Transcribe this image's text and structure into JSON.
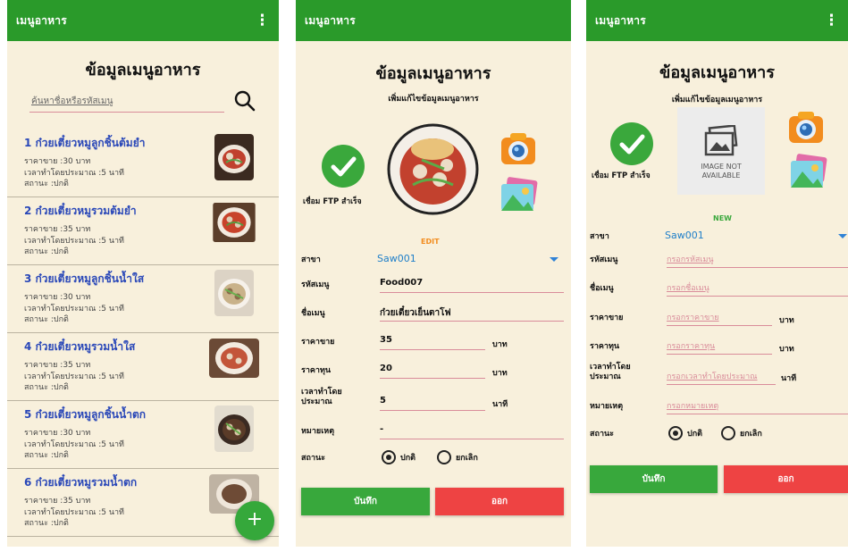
{
  "app_title": "เมนูอาหาร",
  "list_screen": {
    "page_title": "ข้อมูลเมนูอาหาร",
    "search_placeholder": "ค้นหาชื่อหรือรหัสเมนู",
    "items": [
      {
        "name": "1 ก๋วยเตี๋ยวหมูลูกชิ้นต้มยำ",
        "price": "ราคาขาย :30 บาท",
        "time": "เวลาทำโดยประมาณ :5 นาที",
        "status": "สถานะ :ปกติ"
      },
      {
        "name": "2 ก๋วยเตี๋ยวหมูรวมต้มยำ",
        "price": "ราคาขาย :35 บาท",
        "time": "เวลาทำโดยประมาณ :5 นาที",
        "status": "สถานะ :ปกติ"
      },
      {
        "name": "3 ก๋วยเตี๋ยวหมูลูกชิ้นน้ำใส",
        "price": "ราคาขาย :30 บาท",
        "time": "เวลาทำโดยประมาณ :5 นาที",
        "status": "สถานะ :ปกติ"
      },
      {
        "name": "4 ก๋วยเตี๋ยวหมูรวมน้ำใส",
        "price": "ราคาขาย :35 บาท",
        "time": "เวลาทำโดยประมาณ :5 นาที",
        "status": "สถานะ :ปกติ"
      },
      {
        "name": "5 ก๋วยเตี๋ยวหมูลูกชิ้นน้ำตก",
        "price": "ราคาขาย :30 บาท",
        "time": "เวลาทำโดยประมาณ :5 นาที",
        "status": "สถานะ :ปกติ"
      },
      {
        "name": "6 ก๋วยเตี๋ยวหมูรวมน้ำตก",
        "price": "ราคาขาย :35 บาท",
        "time": "เวลาทำโดยประมาณ :5 นาที",
        "status": "สถานะ :ปกติ"
      }
    ],
    "fab_label": "+"
  },
  "edit_screen": {
    "page_title": "ข้อมูลเมนูอาหาร",
    "subtitle": "เพิ่มแก้ไขข้อมูลเมนูอาหาร",
    "ftp_status": "เชื่อม FTP สำเร็จ",
    "mode": "EDIT",
    "labels": {
      "branch": "สาขา",
      "code": "รหัสเมนู",
      "name": "ชื่อเมนู",
      "sell_price": "ราคาขาย",
      "cost_price": "ราคาทุน",
      "time": "เวลาทำโดย ประมาณ",
      "note": "หมายเหตุ",
      "status": "สถานะ"
    },
    "values": {
      "branch": "Saw001",
      "code": "Food007",
      "name": "ก๋วยเตี๋ยวเย็นตาโฟ",
      "sell_price": "35",
      "cost_price": "20",
      "time": "5",
      "note": "-"
    },
    "units": {
      "baht": "บาท",
      "minute": "นาที"
    },
    "status_options": [
      "ปกติ",
      "ยกเลิก"
    ],
    "save_label": "บันทึก",
    "exit_label": "ออก"
  },
  "new_screen": {
    "page_title": "ข้อมูลเมนูอาหาร",
    "subtitle": "เพิ่มแก้ไขข้อมูลเมนูอาหาร",
    "ftp_status": "เชื่อม FTP สำเร็จ",
    "image_placeholder": "IMAGE NOT AVAILABLE",
    "mode": "NEW",
    "labels": {
      "branch": "สาขา",
      "code": "รหัสเมนู",
      "name": "ชื่อเมนู",
      "sell_price": "ราคาขาย",
      "cost_price": "ราคาทุน",
      "time": "เวลาทำโดย ประมาณ",
      "note": "หมายเหตุ",
      "status": "สถานะ"
    },
    "placeholders": {
      "code": "กรอกรหัสเมนู",
      "name": "กรอกชื่อเมนู",
      "sell_price": "กรอกราคาขาย",
      "cost_price": "กรอกราคาทุน",
      "time": "กรอกเวลาทำโดยประมาณ",
      "note": "กรอกหมายเหตุ"
    },
    "branch": "Saw001",
    "units": {
      "baht": "บาท",
      "minute": "นาที"
    },
    "status_options": [
      "ปกติ",
      "ยกเลิก"
    ],
    "save_label": "บันทึก",
    "exit_label": "ออก"
  },
  "colors": {
    "appbar": "#2a9a2a",
    "background": "#f8f0dc",
    "item_title": "#2947b8",
    "accent_orange": "#f28c1e",
    "accent_green": "#3aa83c",
    "exit_red": "#ee4343",
    "branch_blue": "#1f7fc9"
  },
  "icons": [
    "kebab-menu-icon",
    "search-icon",
    "check-circle-icon",
    "camera-icon",
    "gallery-icon",
    "add-icon",
    "dropdown-caret-icon"
  ]
}
